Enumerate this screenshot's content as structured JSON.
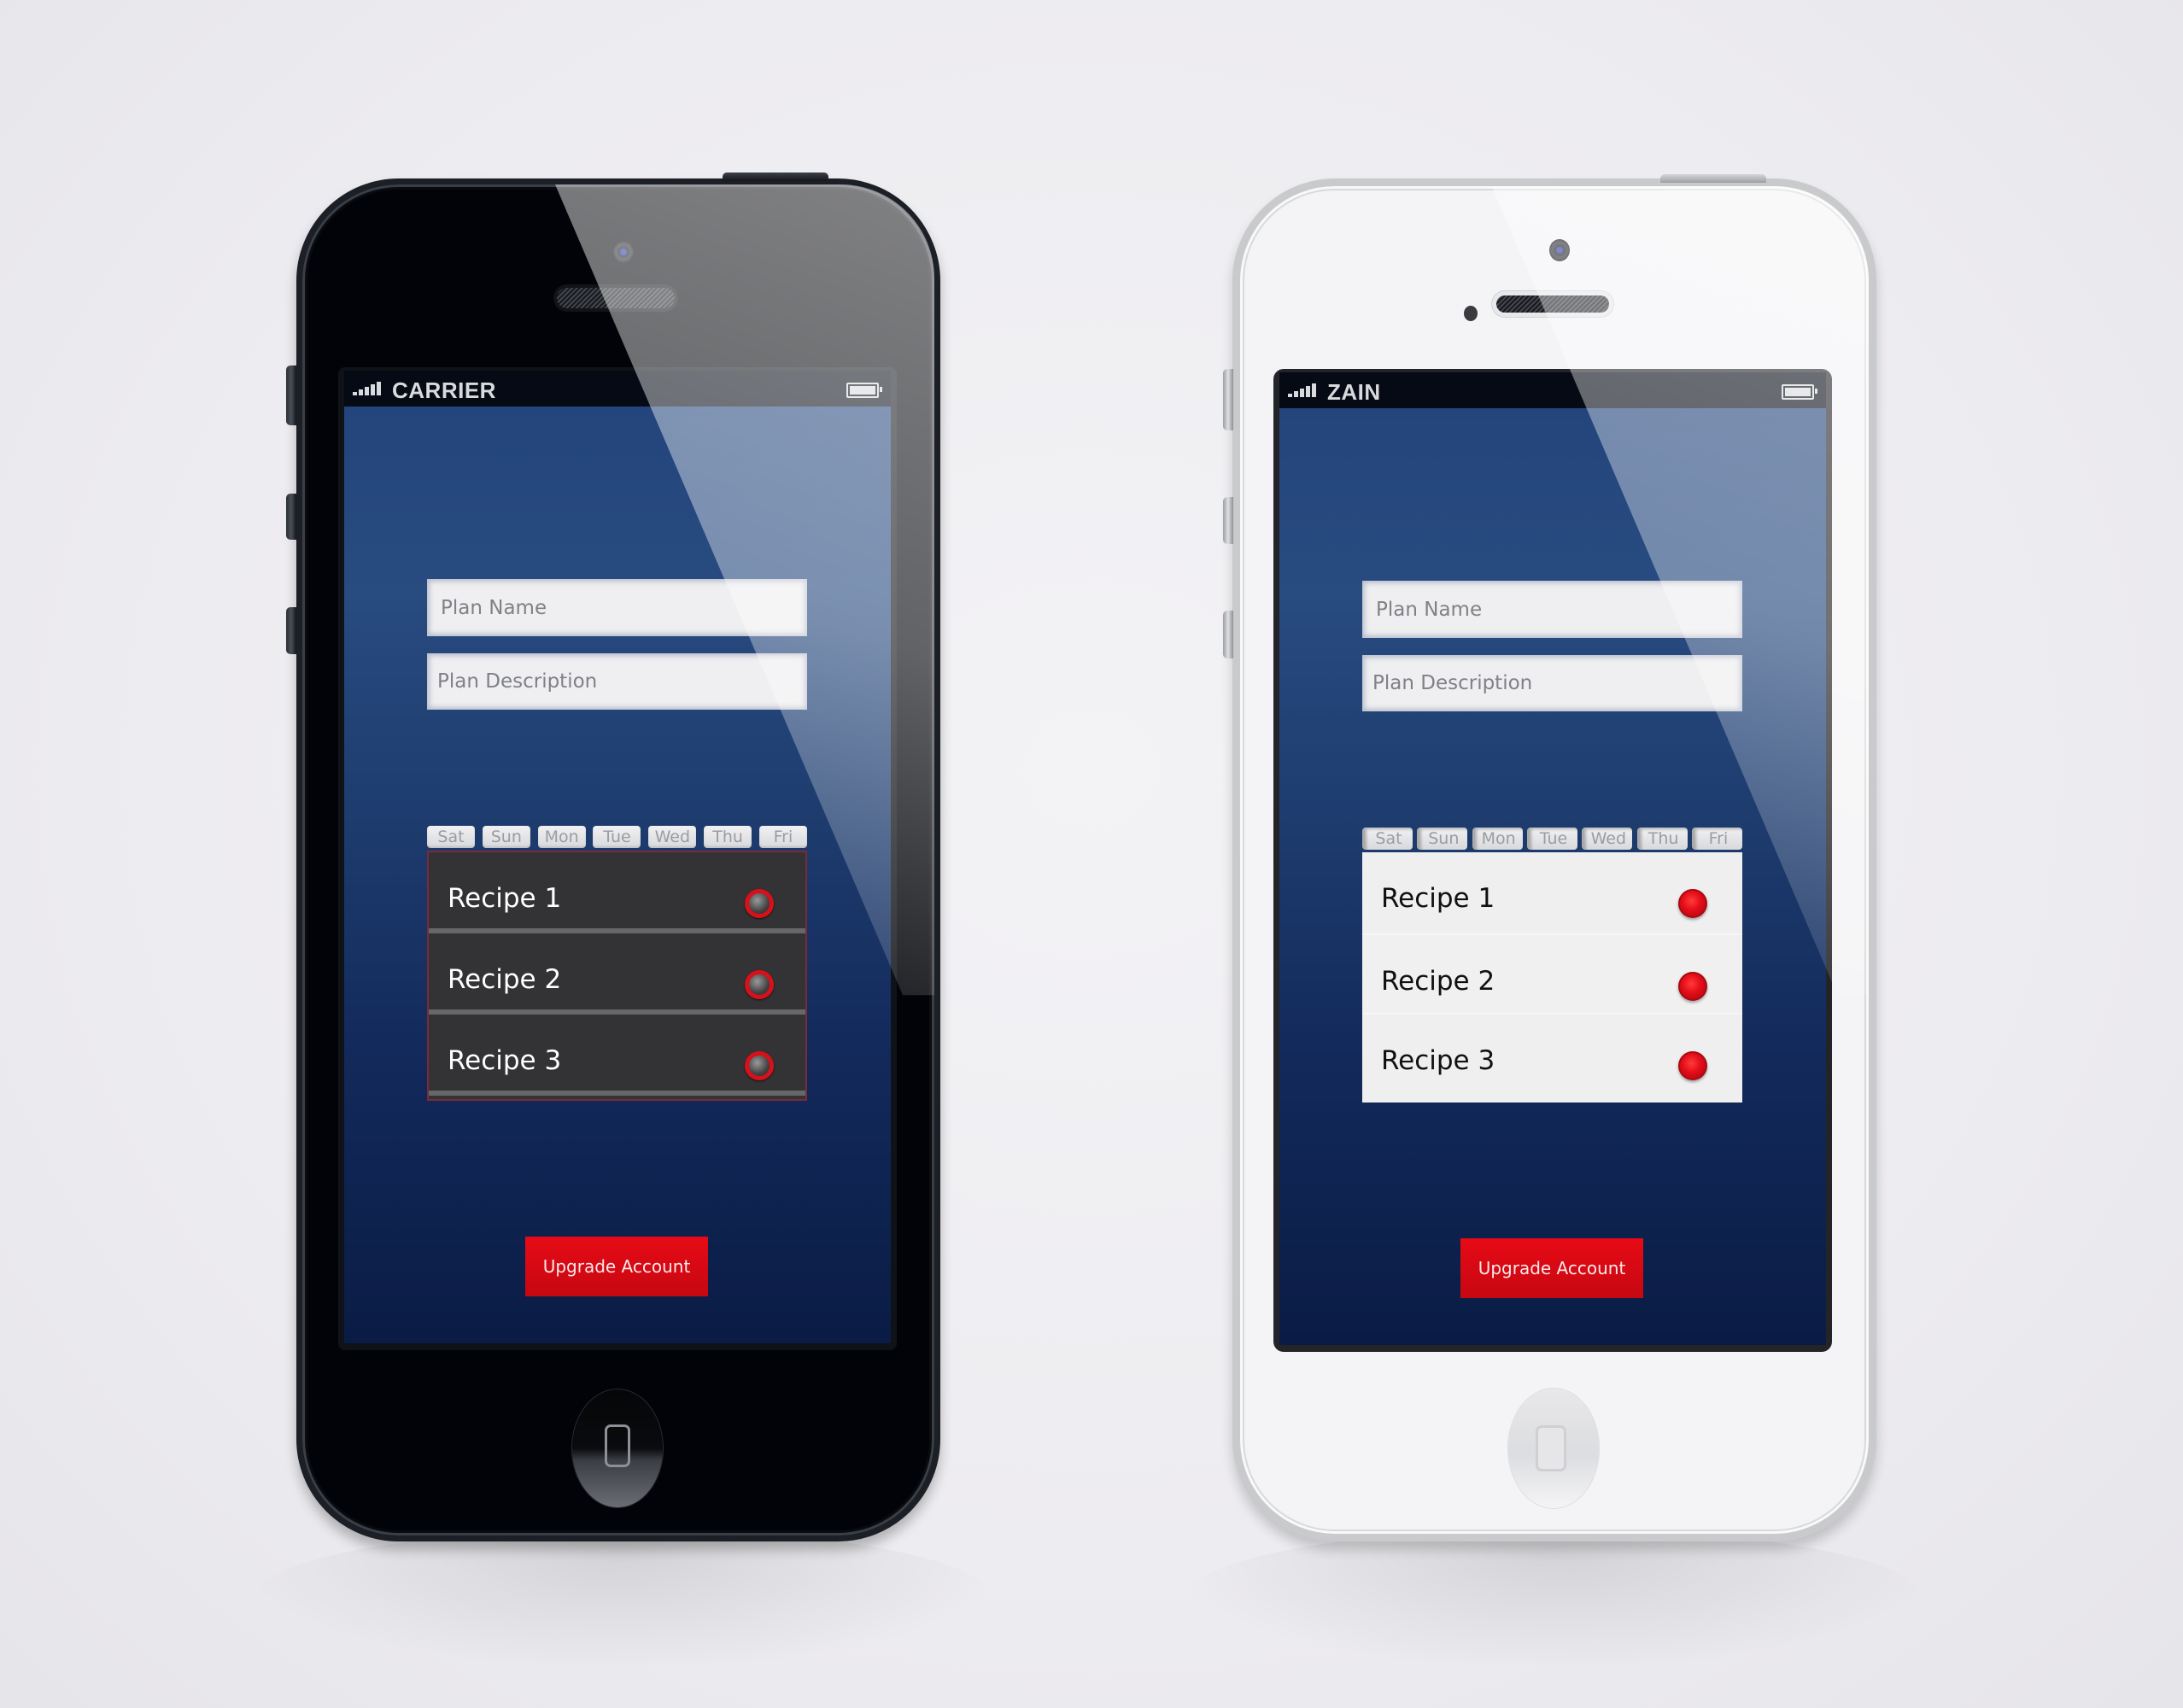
{
  "phones": [
    {
      "variant": "black",
      "status_bar": {
        "carrier": "CARRIER",
        "signal_icon": "signal-bars-icon",
        "battery_icon": "battery-full-icon"
      },
      "form": {
        "plan_name": {
          "value": "",
          "placeholder": "Plan Name"
        },
        "plan_description": {
          "value": "",
          "placeholder": "Plan Description"
        }
      },
      "day_tabs": [
        "Sat",
        "Sun",
        "Mon",
        "Tue",
        "Wed",
        "Thu",
        "Fri"
      ],
      "recipes": [
        {
          "label": "Recipe 1",
          "selected": false
        },
        {
          "label": "Recipe 2",
          "selected": false
        },
        {
          "label": "Recipe 3",
          "selected": false
        }
      ],
      "upgrade_button": "Upgrade Account"
    },
    {
      "variant": "white",
      "status_bar": {
        "carrier": "ZAIN",
        "signal_icon": "signal-bars-icon",
        "battery_icon": "battery-full-icon"
      },
      "form": {
        "plan_name": {
          "value": "",
          "placeholder": "Plan Name"
        },
        "plan_description": {
          "value": "",
          "placeholder": "Plan Description"
        }
      },
      "day_tabs": [
        "Sat",
        "Sun",
        "Mon",
        "Tue",
        "Wed",
        "Thu",
        "Fri"
      ],
      "recipes": [
        {
          "label": "Recipe 1",
          "selected": true
        },
        {
          "label": "Recipe 2",
          "selected": true
        },
        {
          "label": "Recipe 3",
          "selected": true
        }
      ],
      "upgrade_button": "Upgrade Account"
    }
  ],
  "colors": {
    "background": "#edecf0",
    "screen_blue_top": "#23457c",
    "screen_blue_bottom": "#0a1c45",
    "accent_red": "#e00a15",
    "black_list_bg": "#333335",
    "white_list_bg": "#efeff0"
  }
}
